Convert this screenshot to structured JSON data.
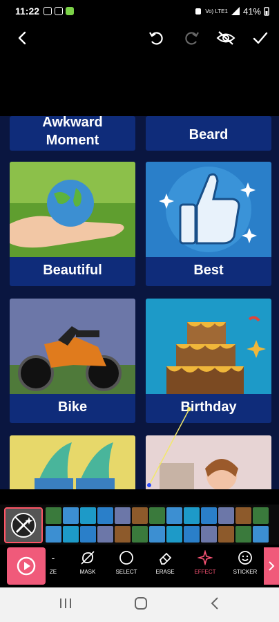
{
  "status": {
    "time": "11:22",
    "network": "Vo) LTE1",
    "battery": "41%",
    "icons": [
      "square-icon",
      "square-icon",
      "green-app-icon"
    ]
  },
  "toolbar": {
    "icons": [
      "back-icon",
      "undo-icon",
      "redo-icon",
      "hide-icon",
      "check-icon"
    ]
  },
  "grid": {
    "top_labels": [
      "Awkward\nMoment",
      "Beard"
    ],
    "cards": [
      {
        "label": "Beautiful"
      },
      {
        "label": "Best"
      },
      {
        "label": "Bike"
      },
      {
        "label": "Birthday"
      },
      {
        "label": ""
      },
      {
        "label": ""
      }
    ]
  },
  "tools": [
    {
      "label": "ZE",
      "icon": "zoom-icon"
    },
    {
      "label": "MASK",
      "icon": "mask-icon"
    },
    {
      "label": "SELECT",
      "icon": "select-icon"
    },
    {
      "label": "ERASE",
      "icon": "eraser-icon"
    },
    {
      "label": "EFFECT",
      "icon": "effect-icon",
      "active": true
    },
    {
      "label": "STICKER",
      "icon": "sticker-icon"
    }
  ],
  "colors": {
    "accent": "#f05a7a",
    "card_bg": "#0f2c7a",
    "grid_bg": "#0a1640"
  }
}
